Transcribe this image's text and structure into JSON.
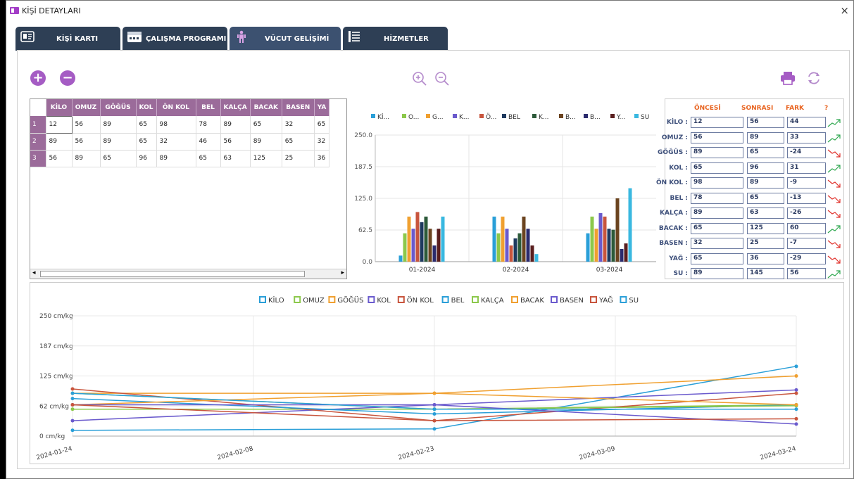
{
  "window": {
    "title": "KİŞİ DETAYLARI",
    "close_glyph": "×"
  },
  "tabs": [
    {
      "label": "KİŞİ KARTI",
      "icon": "id-card-icon"
    },
    {
      "label": "ÇALIŞMA PROGRAMI",
      "icon": "calendar-icon"
    },
    {
      "label": "VÜCUT GELİŞİMİ",
      "icon": "person-icon"
    },
    {
      "label": "HİZMETLER",
      "icon": "list-icon"
    }
  ],
  "toolbar": {
    "add_glyph": "+",
    "remove_glyph": "−"
  },
  "grid": {
    "columns": [
      "KİLO",
      "OMUZ",
      "GÖĞÜS",
      "KOL",
      "ÖN KOL",
      "BEL",
      "KALÇA",
      "BACAK",
      "BASEN",
      "YA"
    ],
    "rows": [
      {
        "num": "1",
        "cells": [
          "12",
          "56",
          "89",
          "65",
          "98",
          "78",
          "89",
          "65",
          "32",
          "65"
        ]
      },
      {
        "num": "2",
        "cells": [
          "89",
          "56",
          "89",
          "65",
          "32",
          "46",
          "56",
          "89",
          "65",
          "32"
        ]
      },
      {
        "num": "3",
        "cells": [
          "56",
          "89",
          "65",
          "96",
          "89",
          "65",
          "63",
          "125",
          "25",
          "36"
        ]
      }
    ],
    "scroll_left": "◂",
    "scroll_right": "▸"
  },
  "comparison": {
    "headers": [
      "ÖNCESİ",
      "SONRASI",
      "FARK",
      "?"
    ],
    "rows": [
      {
        "label": "KİLO :",
        "before": "12",
        "after": "56",
        "diff": "44",
        "trend": "up"
      },
      {
        "label": "OMUZ :",
        "before": "56",
        "after": "89",
        "diff": "33",
        "trend": "up"
      },
      {
        "label": "GÖĞÜS :",
        "before": "89",
        "after": "65",
        "diff": "-24",
        "trend": "down"
      },
      {
        "label": "KOL :",
        "before": "65",
        "after": "96",
        "diff": "31",
        "trend": "up"
      },
      {
        "label": "ÖN KOL :",
        "before": "98",
        "after": "89",
        "diff": "-9",
        "trend": "down"
      },
      {
        "label": "BEL :",
        "before": "78",
        "after": "65",
        "diff": "-13",
        "trend": "down"
      },
      {
        "label": "KALÇA :",
        "before": "89",
        "after": "63",
        "diff": "-26",
        "trend": "down"
      },
      {
        "label": "BACAK :",
        "before": "65",
        "after": "125",
        "diff": "60",
        "trend": "up"
      },
      {
        "label": "BASEN :",
        "before": "32",
        "after": "25",
        "diff": "-7",
        "trend": "down"
      },
      {
        "label": "YAĞ :",
        "before": "65",
        "after": "36",
        "diff": "-29",
        "trend": "down"
      },
      {
        "label": "SU :",
        "before": "89",
        "after": "145",
        "diff": "56",
        "trend": "up"
      }
    ],
    "up_color": "#2fa84f",
    "down_color": "#e0302a"
  },
  "chart_data": [
    {
      "type": "bar",
      "categories": [
        "01-2024",
        "02-2024",
        "03-2024"
      ],
      "legend": [
        "Kİ...",
        "O...",
        "G...",
        "K...",
        "Ö...",
        "BEL",
        "K...",
        "B...",
        "B...",
        "Y...",
        "SU"
      ],
      "ytick_labels": [
        "0.0",
        "62.5",
        "125.0",
        "187.5",
        "250.0"
      ],
      "ylim": [
        0,
        250
      ],
      "series": [
        {
          "values": [
            12,
            89,
            56
          ],
          "color": "#2a9fd8"
        },
        {
          "values": [
            56,
            56,
            89
          ],
          "color": "#8cc84b"
        },
        {
          "values": [
            89,
            89,
            65
          ],
          "color": "#f0a030"
        },
        {
          "values": [
            65,
            65,
            96
          ],
          "color": "#6a5acd"
        },
        {
          "values": [
            98,
            32,
            89
          ],
          "color": "#c8553d"
        },
        {
          "values": [
            78,
            46,
            65
          ],
          "color": "#1f3a5f"
        },
        {
          "values": [
            89,
            56,
            63
          ],
          "color": "#2d5a3a"
        },
        {
          "values": [
            65,
            89,
            125
          ],
          "color": "#6b4420"
        },
        {
          "values": [
            32,
            65,
            25
          ],
          "color": "#2b2b6e"
        },
        {
          "values": [
            65,
            32,
            36
          ],
          "color": "#5a1f1f"
        },
        {
          "values": [
            89,
            15,
            145
          ],
          "color": "#39b8e0"
        }
      ],
      "grid": true,
      "legend_position": "top"
    },
    {
      "type": "line",
      "x": [
        "2024-01-24",
        "2024-02-23",
        "2024-03-24"
      ],
      "xtick_labels": [
        "2024-01-24",
        "2024-02-08",
        "2024-02-23",
        "2024-03-09",
        "2024-03-24"
      ],
      "ytick_labels": [
        "0 cm/kg",
        "62 cm/kg",
        "125 cm/kg",
        "187 cm/kg",
        "250 cm/kg"
      ],
      "ylim": [
        0,
        250
      ],
      "series": [
        {
          "name": "KİLO",
          "values": [
            12,
            15,
            145
          ],
          "color": "#2a9fd8"
        },
        {
          "name": "OMUZ",
          "values": [
            56,
            56,
            65
          ],
          "color": "#8cc84b"
        },
        {
          "name": "GÖĞÜS",
          "values": [
            89,
            89,
            125
          ],
          "color": "#f0a030"
        },
        {
          "name": "KOL",
          "values": [
            32,
            65,
            96
          ],
          "color": "#6a5acd"
        },
        {
          "name": "ÖN KOL",
          "values": [
            98,
            32,
            89
          ],
          "color": "#c8553d"
        },
        {
          "name": "BEL",
          "values": [
            78,
            46,
            65
          ],
          "color": "#2a9fd8"
        },
        {
          "name": "KALÇA",
          "values": [
            89,
            56,
            63
          ],
          "color": "#8cc84b"
        },
        {
          "name": "BACAK",
          "values": [
            65,
            89,
            65
          ],
          "color": "#f0a030"
        },
        {
          "name": "BASEN",
          "values": [
            65,
            65,
            25
          ],
          "color": "#6a5acd"
        },
        {
          "name": "YAĞ",
          "values": [
            65,
            32,
            36
          ],
          "color": "#c8553d"
        },
        {
          "name": "SU",
          "values": [
            89,
            56,
            56
          ],
          "color": "#2a9fd8"
        }
      ],
      "grid": true,
      "legend_position": "top"
    }
  ]
}
